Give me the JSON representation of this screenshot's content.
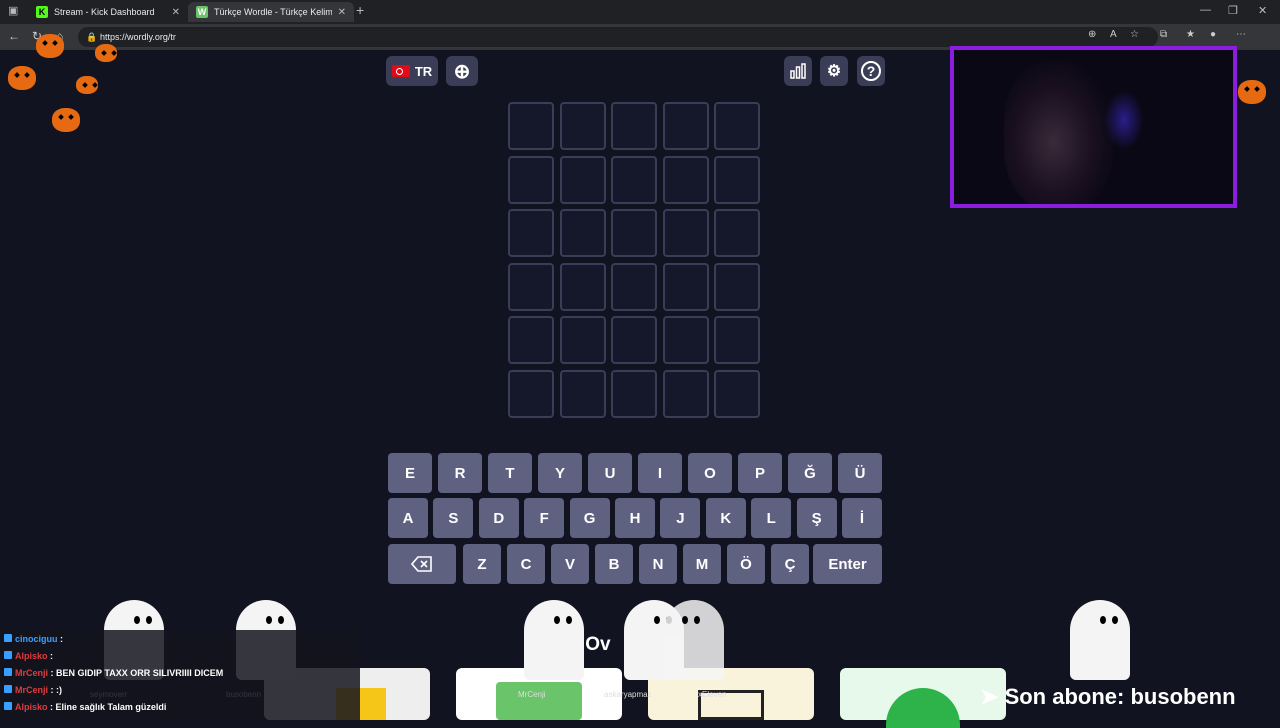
{
  "browser": {
    "tabs": [
      {
        "title": "Stream - Kick Dashboard",
        "icon": "kick-icon"
      },
      {
        "title": "Türkçe Wordle - Türkçe Kelimeler",
        "icon": "wordly-icon"
      }
    ],
    "url": "https://wordly.org/tr"
  },
  "game": {
    "language_label": "TR",
    "rows": 6,
    "cols": 5,
    "keyboard": {
      "row1": [
        "E",
        "R",
        "T",
        "Y",
        "U",
        "I",
        "O",
        "P",
        "Ğ",
        "Ü"
      ],
      "row2": [
        "A",
        "S",
        "D",
        "F",
        "G",
        "H",
        "J",
        "K",
        "L",
        "Ş",
        "İ"
      ],
      "row3": [
        "Z",
        "C",
        "V",
        "B",
        "N",
        "M",
        "Ö",
        "Ç"
      ],
      "enter_label": "Enter"
    },
    "partial_heading": "er Ov"
  },
  "chat": [
    {
      "user": "cinociguu",
      "text": ":",
      "user_color": "blue"
    },
    {
      "user": "Alpisko",
      "text": ":",
      "user_color": "red"
    },
    {
      "user": "MrCenji",
      "text": ": BEN GIDIP TAXX ORR SILIVRIIII DICEM",
      "user_color": "red"
    },
    {
      "user": "MrCenji",
      "text": ": :)",
      "user_color": "red"
    },
    {
      "user": "Alpisko",
      "text": ": Eline sağlık Talam güzeldi",
      "user_color": "red"
    }
  ],
  "overlay": {
    "names": [
      "seymoverr",
      "busobenn",
      "MrCenji",
      "askaryapmaz",
      "xEleven"
    ],
    "last_sub": "Son abone: busobenn"
  }
}
